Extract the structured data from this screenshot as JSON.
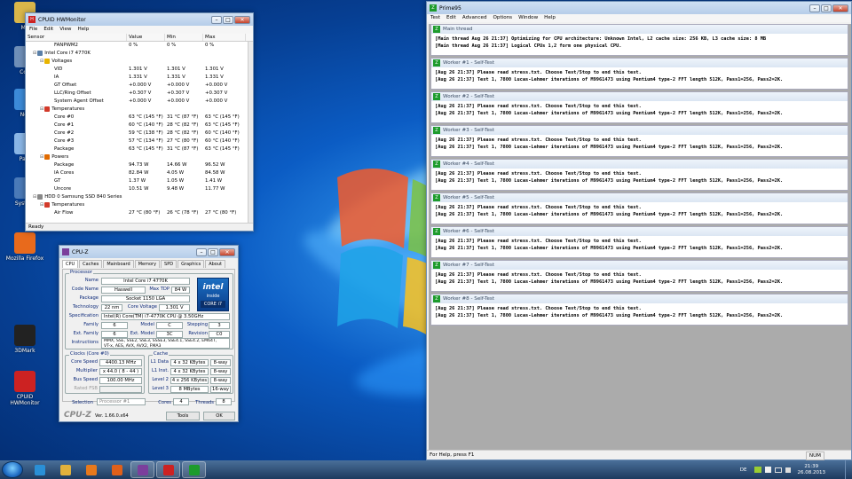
{
  "desktop": {
    "icons": [
      {
        "label": "Ma",
        "color": "#d9b64a"
      },
      {
        "label": "Con",
        "color": "#6f8fb8"
      },
      {
        "label": "Net",
        "color": "#3c8ad8"
      },
      {
        "label": "Papi",
        "color": "#8ab6e6"
      },
      {
        "label": "System",
        "color": "#4a7ab8"
      },
      {
        "label": "Mozilla Firefox",
        "color": "#e86a1c"
      },
      {
        "label": "3DMark",
        "color": "#222222"
      },
      {
        "label": "CPUID HWMonitor",
        "color": "#cc2222"
      }
    ]
  },
  "hwmonitor": {
    "title": "CPUID HWMonitor",
    "menu": [
      "File",
      "Edit",
      "View",
      "Help"
    ],
    "columns": [
      "Sensor",
      "Value",
      "Min",
      "Max"
    ],
    "rows": [
      {
        "indent": 3,
        "icon": "",
        "name": "FANPWM2",
        "value": "0 %",
        "min": "0 %",
        "max": "0 %"
      },
      {
        "indent": 0,
        "icon": "cpu-icon",
        "name": "Intel Core i7 4770K",
        "value": "",
        "min": "",
        "max": ""
      },
      {
        "indent": 1,
        "icon": "voltage-icon",
        "name": "Voltages",
        "value": "",
        "min": "",
        "max": ""
      },
      {
        "indent": 3,
        "icon": "",
        "name": "VID",
        "value": "1.301 V",
        "min": "1.301 V",
        "max": "1.301 V"
      },
      {
        "indent": 3,
        "icon": "",
        "name": "IA",
        "value": "1.331 V",
        "min": "1.331 V",
        "max": "1.331 V"
      },
      {
        "indent": 3,
        "icon": "",
        "name": "GT Offset",
        "value": "+0.000 V",
        "min": "+0.000 V",
        "max": "+0.000 V"
      },
      {
        "indent": 3,
        "icon": "",
        "name": "LLC/Ring Offset",
        "value": "+0.307 V",
        "min": "+0.307 V",
        "max": "+0.307 V"
      },
      {
        "indent": 3,
        "icon": "",
        "name": "System Agent Offset",
        "value": "+0.000 V",
        "min": "+0.000 V",
        "max": "+0.000 V"
      },
      {
        "indent": 1,
        "icon": "temperature-icon",
        "name": "Temperatures",
        "value": "",
        "min": "",
        "max": ""
      },
      {
        "indent": 3,
        "icon": "",
        "name": "Core #0",
        "value": "63 °C (145 °F)",
        "min": "31 °C (87 °F)",
        "max": "63 °C (145 °F)"
      },
      {
        "indent": 3,
        "icon": "",
        "name": "Core #1",
        "value": "60 °C (140 °F)",
        "min": "28 °C (82 °F)",
        "max": "63 °C (145 °F)"
      },
      {
        "indent": 3,
        "icon": "",
        "name": "Core #2",
        "value": "59 °C (138 °F)",
        "min": "28 °C (82 °F)",
        "max": "60 °C (140 °F)"
      },
      {
        "indent": 3,
        "icon": "",
        "name": "Core #3",
        "value": "57 °C (134 °F)",
        "min": "27 °C (80 °F)",
        "max": "60 °C (140 °F)"
      },
      {
        "indent": 3,
        "icon": "",
        "name": "Package",
        "value": "63 °C (145 °F)",
        "min": "31 °C (87 °F)",
        "max": "63 °C (145 °F)"
      },
      {
        "indent": 1,
        "icon": "power-icon",
        "name": "Powers",
        "value": "",
        "min": "",
        "max": ""
      },
      {
        "indent": 3,
        "icon": "",
        "name": "Package",
        "value": "94.73 W",
        "min": "14.66 W",
        "max": "96.52 W"
      },
      {
        "indent": 3,
        "icon": "",
        "name": "IA Cores",
        "value": "82.84 W",
        "min": "4.05 W",
        "max": "84.58 W"
      },
      {
        "indent": 3,
        "icon": "",
        "name": "GT",
        "value": "1.37 W",
        "min": "1.05 W",
        "max": "1.41 W"
      },
      {
        "indent": 3,
        "icon": "",
        "name": "Uncore",
        "value": "10.51 W",
        "min": "9.48 W",
        "max": "11.77 W"
      },
      {
        "indent": 0,
        "icon": "hdd-icon",
        "name": "HDD 0 Samsung SSD 840 Series",
        "value": "",
        "min": "",
        "max": ""
      },
      {
        "indent": 1,
        "icon": "temperature-icon",
        "name": "Temperatures",
        "value": "",
        "min": "",
        "max": ""
      },
      {
        "indent": 3,
        "icon": "",
        "name": "Air Flow",
        "value": "27 °C (80 °F)",
        "min": "26 °C (78 °F)",
        "max": "27 °C (80 °F)"
      }
    ],
    "status": "Ready"
  },
  "cpuz": {
    "title": "CPU-Z",
    "tabs": [
      "CPU",
      "Caches",
      "Mainboard",
      "Memory",
      "SPD",
      "Graphics",
      "About"
    ],
    "processor_legend": "Processor",
    "name_label": "Name",
    "name": "Intel Core i7 4770K",
    "codename_label": "Code Name",
    "codename": "Haswell",
    "maxtdp_label": "Max TDP",
    "maxtdp": "84 W",
    "package_label": "Package",
    "package": "Socket 1150 LGA",
    "tech_label": "Technology",
    "tech": "22 nm",
    "corev_label": "Core Voltage",
    "corev": "1.301 V",
    "spec_label": "Specification",
    "spec": "Intel(R) Core(TM) i7-4770K CPU @ 3.50GHz",
    "family_label": "Family",
    "family": "6",
    "model_label": "Model",
    "model": "C",
    "stepping_label": "Stepping",
    "stepping": "3",
    "extfamily_label": "Ext. Family",
    "extfamily": "6",
    "extmodel_label": "Ext. Model",
    "extmodel": "3C",
    "revision_label": "Revision",
    "revision": "C0",
    "instr_label": "Instructions",
    "instr1": "MMX, SSE, SSE2, SSE3, SSSE3, SSE4.1, SSE4.2, EM64T,",
    "instr2": "VT-x, AES, AVX, AVX2, FMA3",
    "clocks_legend": "Clocks (Core #0)",
    "corespeed_label": "Core Speed",
    "corespeed": "4400.13 MHz",
    "multiplier_label": "Multiplier",
    "multiplier": "x 44.0 ( 8 - 44 )",
    "busspeed_label": "Bus Speed",
    "busspeed": "100.00 MHz",
    "ratedfsb_label": "Rated FSB",
    "cache_legend": "Cache",
    "caches": [
      {
        "label": "L1 Data",
        "size": "4 x 32 KBytes",
        "way": "8-way"
      },
      {
        "label": "L1 Inst.",
        "size": "4 x 32 KBytes",
        "way": "8-way"
      },
      {
        "label": "Level 2",
        "size": "4 x 256 KBytes",
        "way": "8-way"
      },
      {
        "label": "Level 3",
        "size": "8 MBytes",
        "way": "16-way"
      }
    ],
    "selection_label": "Selection",
    "selection": "Processor #1",
    "cores_label": "Cores",
    "cores": "4",
    "threads_label": "Threads",
    "threads": "8",
    "logo": "CPU-Z",
    "version": "Ver. 1.66.0.x64",
    "tools_label": "Tools",
    "ok_label": "OK",
    "intel_brand": "intel",
    "intel_inside": "inside",
    "intel_core": "CORE i7"
  },
  "prime95": {
    "title": "Prime95",
    "menu": [
      "Test",
      "Edit",
      "Advanced",
      "Options",
      "Window",
      "Help"
    ],
    "windows": [
      {
        "title": "Main thread",
        "lines": [
          "[Main thread Aug 26 21:37] Optimizing for CPU architecture: Unknown Intel, L2 cache size: 256 KB, L3 cache size: 8 MB",
          "[Main thread Aug 26 21:37] Logical CPUs 1,2 form one physical CPU."
        ]
      },
      {
        "title": "Worker #1 - Self-Test",
        "lines": [
          "[Aug 26 21:37] Please read stress.txt.  Choose Test/Stop to end this test.",
          "[Aug 26 21:37] Test 1, 7800 Lucas-Lehmer iterations of M9961473 using Pentium4 type-2 FFT length 512K, Pass1=256, Pass2=2K."
        ]
      },
      {
        "title": "Worker #2 - Self-Test",
        "lines": [
          "[Aug 26 21:37] Please read stress.txt.  Choose Test/Stop to end this test.",
          "[Aug 26 21:37] Test 1, 7800 Lucas-Lehmer iterations of M9961473 using Pentium4 type-2 FFT length 512K, Pass1=256, Pass2=2K."
        ]
      },
      {
        "title": "Worker #3 - Self-Test",
        "lines": [
          "[Aug 26 21:37] Please read stress.txt.  Choose Test/Stop to end this test.",
          "[Aug 26 21:37] Test 1, 7800 Lucas-Lehmer iterations of M9961473 using Pentium4 type-2 FFT length 512K, Pass1=256, Pass2=2K."
        ]
      },
      {
        "title": "Worker #4 - Self-Test",
        "lines": [
          "[Aug 26 21:37] Please read stress.txt.  Choose Test/Stop to end this test.",
          "[Aug 26 21:37] Test 1, 7800 Lucas-Lehmer iterations of M9961473 using Pentium4 type-2 FFT length 512K, Pass1=256, Pass2=2K."
        ]
      },
      {
        "title": "Worker #5 - Self-Test",
        "lines": [
          "[Aug 26 21:37] Please read stress.txt.  Choose Test/Stop to end this test.",
          "[Aug 26 21:37] Test 1, 7800 Lucas-Lehmer iterations of M9961473 using Pentium4 type-2 FFT length 512K, Pass1=256, Pass2=2K."
        ]
      },
      {
        "title": "Worker #6 - Self-Test",
        "lines": [
          "[Aug 26 21:37] Please read stress.txt.  Choose Test/Stop to end this test.",
          "[Aug 26 21:37] Test 1, 7800 Lucas-Lehmer iterations of M9961473 using Pentium4 type-2 FFT length 512K, Pass1=256, Pass2=2K."
        ]
      },
      {
        "title": "Worker #7 - Self-Test",
        "lines": [
          "[Aug 26 21:37] Please read stress.txt.  Choose Test/Stop to end this test.",
          "[Aug 26 21:37] Test 1, 7800 Lucas-Lehmer iterations of M9961473 using Pentium4 type-2 FFT length 512K, Pass1=256, Pass2=2K."
        ]
      },
      {
        "title": "Worker #8 - Self-Test",
        "lines": [
          "[Aug 26 21:37] Please read stress.txt.  Choose Test/Stop to end this test.",
          "[Aug 26 21:37] Test 1, 7800 Lucas-Lehmer iterations of M9961473 using Pentium4 type-2 FFT length 512K, Pass1=256, Pass2=2K."
        ]
      }
    ],
    "status_left": "For Help, press F1",
    "status_right": "NUM"
  },
  "taskbar": {
    "apps": [
      {
        "name": "taskbar-ie-icon",
        "color": "#2a8fd6"
      },
      {
        "name": "taskbar-explorer-icon",
        "color": "#e2b13c"
      },
      {
        "name": "taskbar-media-icon",
        "color": "#e8791c"
      },
      {
        "name": "taskbar-firefox-icon",
        "color": "#e0601a"
      },
      {
        "name": "taskbar-cpuz-icon",
        "color": "#7b3f9c"
      },
      {
        "name": "taskbar-hwmonitor-icon",
        "color": "#cc2222"
      },
      {
        "name": "taskbar-prime95-icon",
        "color": "#1d9b2c"
      }
    ],
    "lang": "DE",
    "time": "21:39",
    "date": "26.08.2013"
  }
}
